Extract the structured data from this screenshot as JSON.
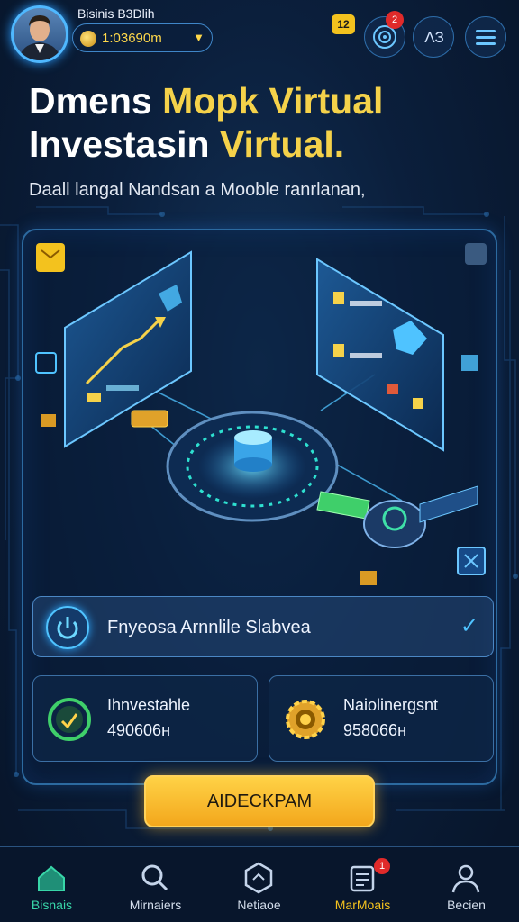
{
  "header": {
    "username": "Bisinis B3Dlih",
    "balance": "1:03690m",
    "badge": "12",
    "notification_count": "2",
    "level_text": "ΛЗ"
  },
  "hero": {
    "title_line1_white": "Dmens ",
    "title_line1_gold": "Mopk Virtual",
    "title_line2_white": "Investasin ",
    "title_line2_gold": "Virtual.",
    "subtitle": "Daall langal Nandsan a Mooble ranrlanan,"
  },
  "card": {
    "row_text": "Fnyeosa Arnnlile Slabvea",
    "stats": [
      {
        "label": "Ihnvestahle",
        "value": "490606н",
        "icon": "growth-icon"
      },
      {
        "label": "Naiolinergsnt",
        "value": "958066н",
        "icon": "gear-coin-icon"
      }
    ]
  },
  "cta": {
    "label": "AIDECKPAM"
  },
  "nav": {
    "items": [
      {
        "label": "Bisnais",
        "icon": "home-icon"
      },
      {
        "label": "Mirnaiers",
        "icon": "search-icon"
      },
      {
        "label": "Netiaoe",
        "icon": "cube-icon"
      },
      {
        "label": "MarMoais",
        "icon": "document-icon",
        "badge": "1"
      },
      {
        "label": "Becien",
        "icon": "profile-icon"
      }
    ]
  },
  "colors": {
    "accent_blue": "#4fc3ff",
    "gold": "#f5d24a",
    "active_green": "#38d6a8",
    "background": "#0b1f3c"
  }
}
